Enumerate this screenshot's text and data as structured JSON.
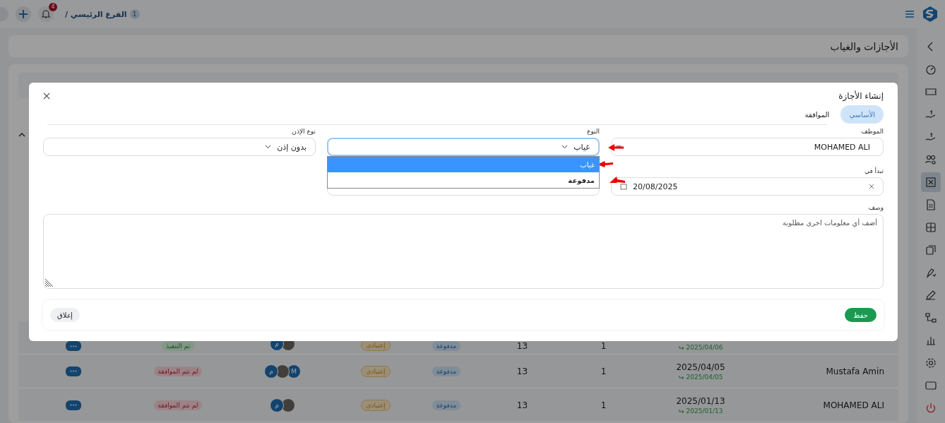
{
  "topbar": {
    "branch_count": "1",
    "branch": "الفرع الرئيسي /",
    "notifications": "4"
  },
  "sidebar": {
    "items": [
      {
        "kind": "chevron",
        "selected": false
      },
      {
        "kind": "gauge",
        "selected": false
      },
      {
        "kind": "ticket",
        "selected": false
      },
      {
        "kind": "hand-coin",
        "selected": false
      },
      {
        "kind": "hand-coin",
        "selected": false
      },
      {
        "kind": "users-gear",
        "selected": false
      },
      {
        "kind": "x-square",
        "selected": true
      },
      {
        "kind": "document",
        "selected": false
      },
      {
        "kind": "grid",
        "selected": false
      },
      {
        "kind": "cards",
        "selected": false
      },
      {
        "kind": "pen-check",
        "selected": false
      },
      {
        "kind": "pen",
        "selected": false
      },
      {
        "kind": "flow",
        "selected": false
      },
      {
        "kind": "bars",
        "selected": false
      },
      {
        "kind": "gear",
        "selected": false
      },
      {
        "kind": "screen",
        "selected": false
      },
      {
        "kind": "power",
        "selected": false
      }
    ]
  },
  "page": {
    "title": "الأجازات والغياب"
  },
  "table": {
    "rows": [
      {
        "return_date": "2025/04/06",
        "days": "1",
        "balance": "13",
        "paid": "مدفوعة",
        "type": "إعتيادي",
        "avatars": [
          {
            "kind": "photo"
          },
          {
            "kind": "letter",
            "text": "م"
          }
        ],
        "status": {
          "text": "تم التنفيذ",
          "kind": "done"
        }
      },
      {
        "name": "Mustafa Amin",
        "date": "2025/04/05",
        "return_date": "2025/04/05",
        "days": "1",
        "balance": "13",
        "paid": "مدفوعة",
        "type": "إعتيادي",
        "avatars": [
          {
            "kind": "letter",
            "text": "M"
          },
          {
            "kind": "photo"
          },
          {
            "kind": "letter",
            "text": "م"
          }
        ],
        "status": {
          "text": "لم تتم الموافقة",
          "kind": "rejected"
        }
      },
      {
        "name": "MOHAMED ALI",
        "date": "2025/01/13",
        "return_date": "2025/01/13",
        "days": "1",
        "balance": "13",
        "paid": "مدفوعة",
        "type": "إعتيادي",
        "avatars": [
          {
            "kind": "photo"
          },
          {
            "kind": "letter",
            "text": "م"
          }
        ],
        "status": {
          "text": "لم تتم الموافقة",
          "kind": "rejected"
        }
      }
    ]
  },
  "modal": {
    "title": "إنشاء الأجازة",
    "tabs": [
      {
        "label": "الأساسي",
        "selected": true
      },
      {
        "label": "الموافقة",
        "selected": false
      }
    ],
    "employee": {
      "label": "الموظف",
      "value": "MOHAMED ALI"
    },
    "type": {
      "label": "النوع",
      "value": "غياب",
      "expanded": true,
      "options": [
        {
          "label": "غياب",
          "selected": true
        },
        {
          "label": "مدفوعة",
          "selected": false
        }
      ]
    },
    "permission": {
      "label": "نوع الإذن",
      "value": "بدون إذن"
    },
    "start": {
      "label": "تبدأ في",
      "value": "20/08/2025"
    },
    "description": {
      "label": "وصف",
      "placeholder": "أضف أي معلومات اخرى مطلوبة"
    },
    "save": "حفظ",
    "close": "إغلاق"
  }
}
